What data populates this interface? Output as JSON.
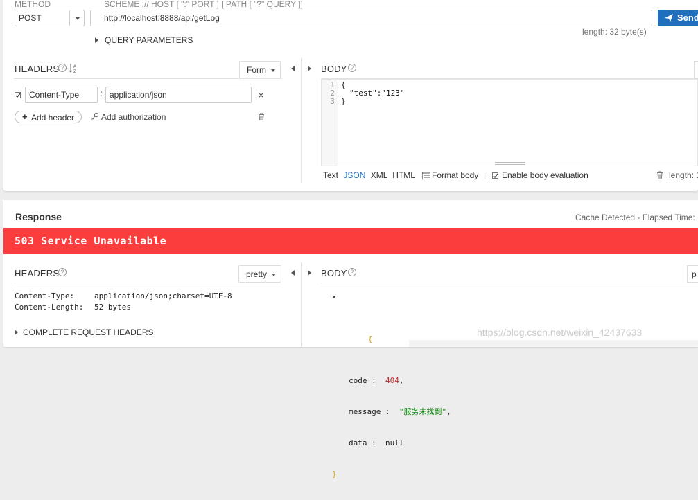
{
  "request": {
    "method_label": "METHOD",
    "url_label": "SCHEME :// HOST [ \":\" PORT ] [ PATH [ \"?\" QUERY ]]",
    "method_value": "POST",
    "url_value": "http://localhost:8888/api/getLog",
    "send_label": "Send",
    "length_text": "length: 32 byte(s)",
    "query_params_label": "QUERY PARAMETERS",
    "headers": {
      "title": "HEADERS",
      "mode": "Form",
      "rows": [
        {
          "name": "Content-Type",
          "value": "application/json",
          "checked": true
        }
      ],
      "add_header": "Add header",
      "add_authorization": "Add authorization"
    },
    "body": {
      "title": "BODY",
      "lines": [
        "1",
        "2",
        "3"
      ],
      "code": {
        "open": "{",
        "key": "\"test\"",
        "colon": ":",
        "value": "\"123\"",
        "close": "}"
      },
      "formats": [
        "Text",
        "JSON",
        "XML",
        "HTML"
      ],
      "active_format": "JSON",
      "separator": "|",
      "format_body": "Format body",
      "enable_eval": "Enable body evaluation",
      "length_text": "length: 1"
    }
  },
  "response": {
    "title": "Response",
    "cache_text": "Cache Detected - Elapsed Time:",
    "status": "503 Service Unavailable",
    "headers": {
      "title": "HEADERS",
      "mode": "pretty",
      "items": [
        {
          "name": "Content-Type:",
          "value": "application/json;charset=UTF-8"
        },
        {
          "name": "Content-Length:",
          "value": "52 bytes"
        }
      ],
      "complete_label": "COMPLETE REQUEST HEADERS"
    },
    "body": {
      "title": "BODY",
      "mode_partial": "p",
      "open": "{",
      "close": "}",
      "fields": [
        {
          "key": "code",
          "sep": " :  ",
          "value": "404",
          "type": "num",
          "trail": ","
        },
        {
          "key": "message",
          "sep": " :  ",
          "value": "\"服务未找到\"",
          "type": "str",
          "trail": ","
        },
        {
          "key": "data",
          "sep": " :  ",
          "value": "null",
          "type": "null",
          "trail": ""
        }
      ]
    },
    "watermark": "https://blog.csdn.net/weixin_42437633"
  },
  "colors": {
    "send_button": "#1f6fbd",
    "status_error": "#fb3d3d",
    "link_blue": "#1f74c7"
  }
}
